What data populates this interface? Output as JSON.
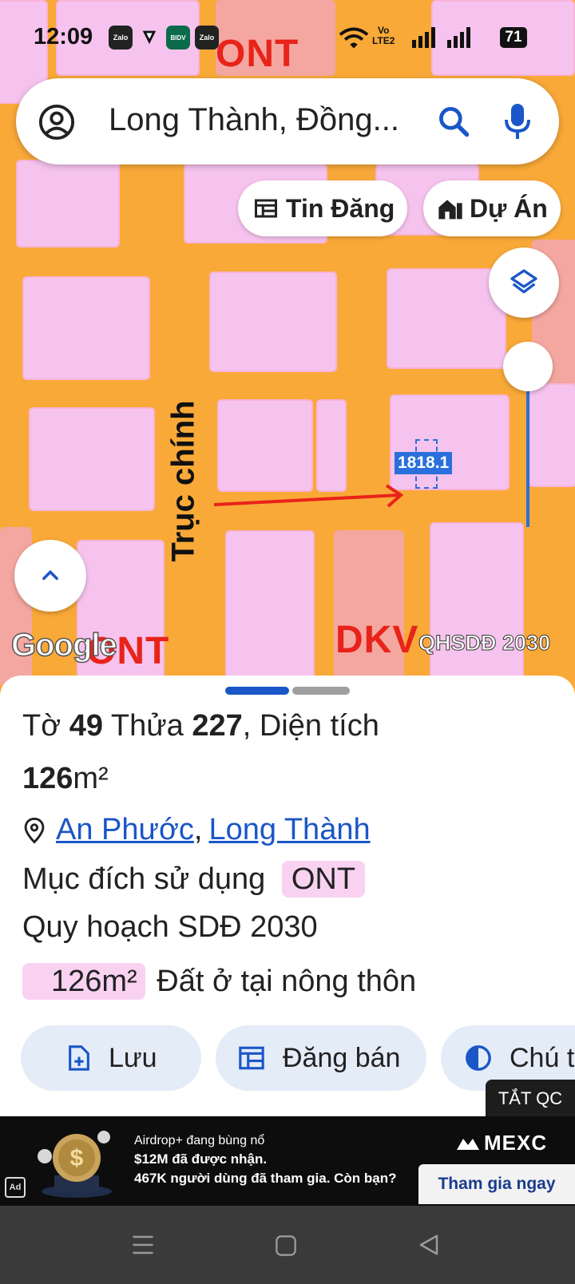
{
  "status_bar": {
    "time": "12:09",
    "icons": [
      "zalo-icon",
      "shield-icon",
      "bidv-icon",
      "zalo-icon"
    ],
    "app_labels": [
      "Zalo",
      "BIDV",
      "Zalo"
    ],
    "network_label_top": "Vo",
    "network_label_bottom": "LTE2",
    "battery": "71"
  },
  "search": {
    "text": "Long Thành, Đồng..."
  },
  "chips": {
    "listings": "Tin Đăng",
    "projects": "Dự Án"
  },
  "map": {
    "zone_labels": {
      "top": "ONT",
      "bottom_left": "ONT",
      "bottom_right": "DKV"
    },
    "road_label": "Trục chính",
    "parcel_label": "1818.1",
    "attribution": "Google",
    "layer_badge": "QHSDĐ 2030",
    "colors": {
      "road": "#f9a938",
      "residential": "#f6c3ee",
      "other": "#f4a7a0",
      "arrow": "#e8231a"
    }
  },
  "parcel": {
    "sheet_prefix": "Tờ",
    "sheet_no": "49",
    "plot_prefix": "Thửa",
    "plot_no": "227",
    "area_prefix": ", Diện tích",
    "area_value": "126",
    "area_unit": "m²",
    "ward": "An Phước",
    "comma": ",",
    "district": "Long Thành",
    "purpose_label": "Mục đích sử dụng",
    "purpose_code": "ONT",
    "plan_label": "Quy hoạch SDĐ 2030",
    "plan_area": "126m²",
    "plan_desc": "Đất ở tại nông thôn"
  },
  "actions": {
    "save": "Lưu",
    "sell": "Đăng bán",
    "note": "Chú t"
  },
  "ad": {
    "hide_label": "TẮT QC",
    "badge": "Ad",
    "line1": "Airdrop+ đang bùng nổ",
    "line2": "$12M đã được nhận.",
    "line3": "467K người dùng đã tham gia. Còn bạn?",
    "brand": "MEXC",
    "cta": "Tham gia ngay"
  },
  "accent_color": "#1a56c7"
}
